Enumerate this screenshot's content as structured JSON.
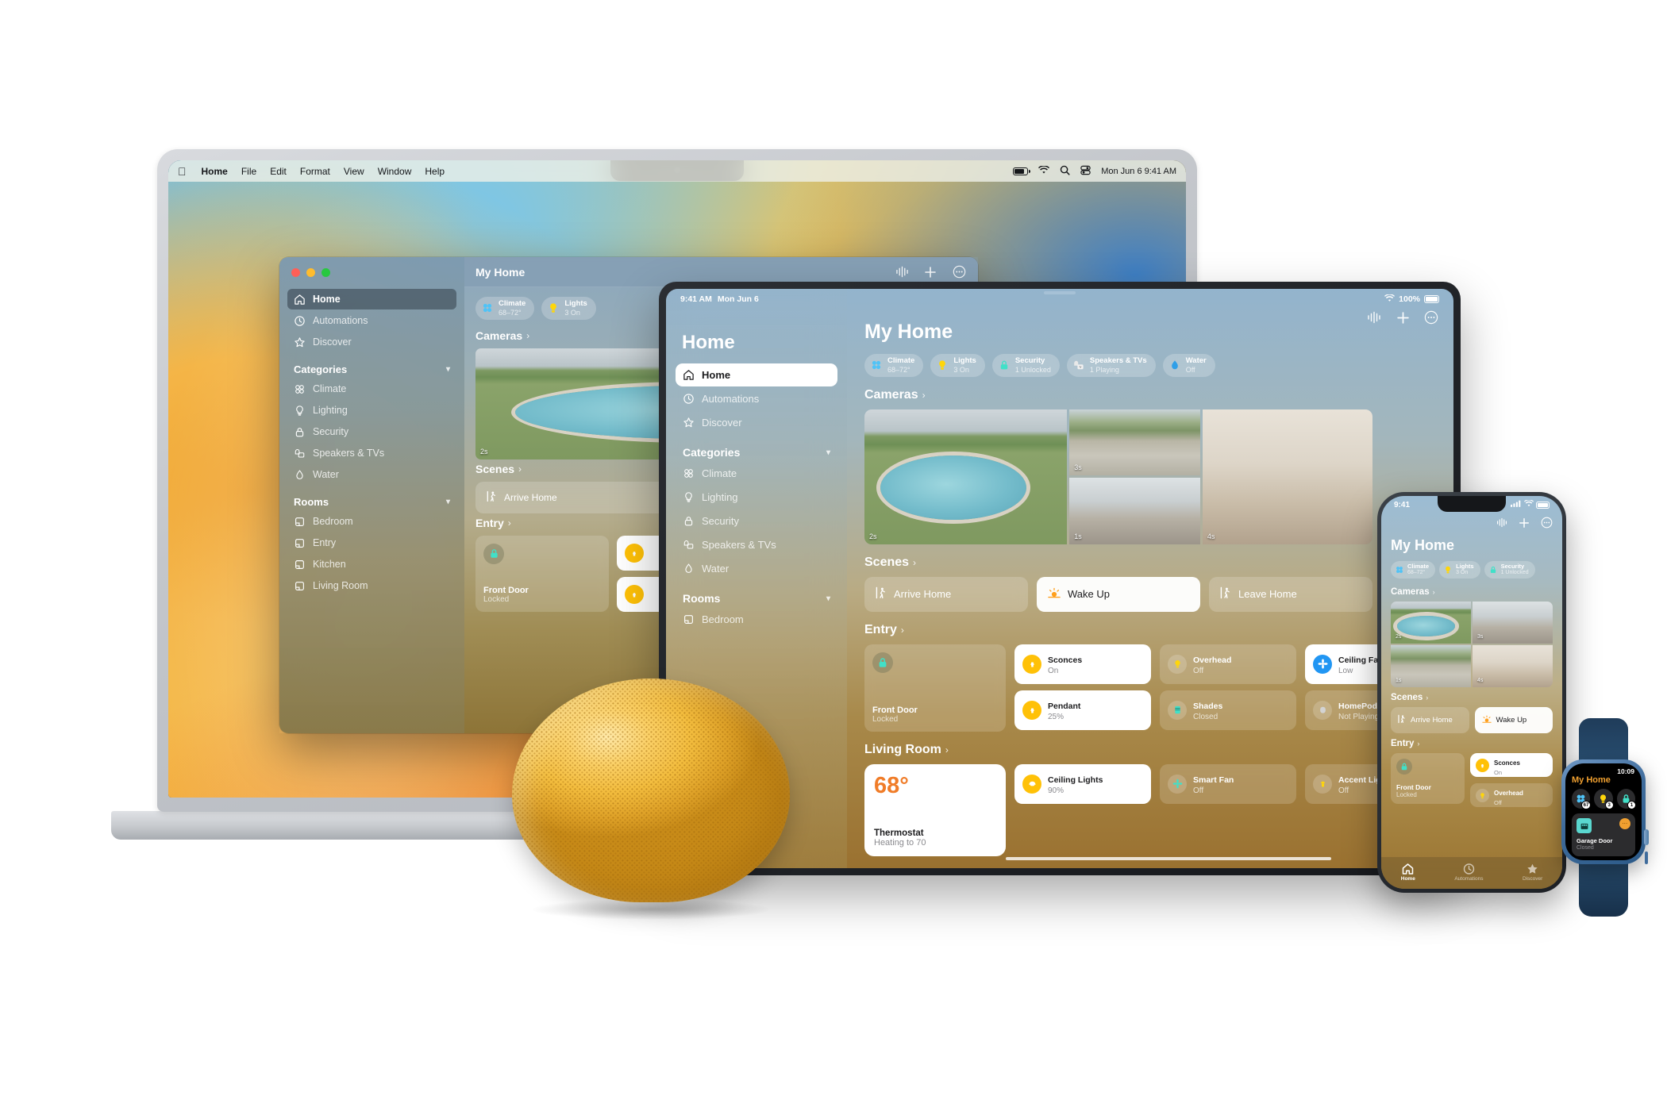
{
  "mac": {
    "menubar": {
      "apple": "apple-logo",
      "items": [
        "Home",
        "File",
        "Edit",
        "Format",
        "View",
        "Window",
        "Help"
      ],
      "status_icons": [
        "battery-icon",
        "wifi-icon",
        "search-icon",
        "control-center-icon"
      ],
      "datetime": "Mon Jun 6  9:41 AM"
    },
    "window": {
      "title": "My Home",
      "toolbar_icons": [
        "siri-waveform-icon",
        "add-icon",
        "more-options-icon"
      ],
      "sidebar": {
        "primary": [
          {
            "label": "Home",
            "icon": "house-icon",
            "selected": true
          },
          {
            "label": "Automations",
            "icon": "clock-automation-icon",
            "selected": false
          },
          {
            "label": "Discover",
            "icon": "star-icon",
            "selected": false
          }
        ],
        "categories_header": "Categories",
        "categories": [
          {
            "label": "Climate",
            "icon": "fan-icon"
          },
          {
            "label": "Lighting",
            "icon": "bulb-icon"
          },
          {
            "label": "Security",
            "icon": "lock-icon"
          },
          {
            "label": "Speakers & TVs",
            "icon": "speaker-tv-icon"
          },
          {
            "label": "Water",
            "icon": "water-drop-icon"
          }
        ],
        "rooms_header": "Rooms",
        "rooms": [
          {
            "label": "Bedroom",
            "icon": "room-icon"
          },
          {
            "label": "Entry",
            "icon": "room-icon"
          },
          {
            "label": "Kitchen",
            "icon": "room-icon"
          },
          {
            "label": "Living Room",
            "icon": "room-icon"
          }
        ]
      },
      "status_pills": [
        {
          "name": "Climate",
          "value": "68–72°",
          "icon": "fan-icon",
          "color": "#4fc3f7"
        },
        {
          "name": "Lights",
          "value": "3 On",
          "icon": "bulb-icon",
          "color": "#ffd60a"
        }
      ],
      "sections": {
        "cameras": "Cameras",
        "scenes": "Scenes",
        "entry": "Entry"
      },
      "cameras": [
        {
          "name": "pool-camera",
          "timestamp": "2s"
        }
      ],
      "scenes": [
        {
          "label": "Arrive Home",
          "icon": "walk-in-icon",
          "active": false
        }
      ],
      "entry": {
        "lock": {
          "name": "Front Door",
          "state": "Locked",
          "icon": "lock-icon"
        }
      }
    },
    "dock": [
      {
        "name": "finder-icon"
      },
      {
        "name": "launchpad-icon"
      },
      {
        "name": "safari-icon"
      },
      {
        "name": "messages-icon"
      },
      {
        "name": "mail-icon"
      },
      {
        "name": "maps-icon"
      },
      {
        "name": "photos-icon"
      }
    ]
  },
  "ipad": {
    "status": {
      "time": "9:41 AM",
      "date": "Mon Jun 6",
      "wifi": "wifi-icon",
      "battery_pct": "100%"
    },
    "sidebar": {
      "title": "Home",
      "primary": [
        {
          "label": "Home",
          "icon": "house-icon",
          "selected": true
        },
        {
          "label": "Automations",
          "icon": "clock-automation-icon",
          "selected": false
        },
        {
          "label": "Discover",
          "icon": "star-icon",
          "selected": false
        }
      ],
      "categories_header": "Categories",
      "categories": [
        {
          "label": "Climate",
          "icon": "fan-icon"
        },
        {
          "label": "Lighting",
          "icon": "bulb-icon"
        },
        {
          "label": "Security",
          "icon": "lock-icon"
        },
        {
          "label": "Speakers & TVs",
          "icon": "speaker-tv-icon"
        },
        {
          "label": "Water",
          "icon": "water-drop-icon"
        }
      ],
      "rooms_header": "Rooms",
      "rooms": [
        {
          "label": "Bedroom",
          "icon": "room-icon"
        }
      ]
    },
    "title": "My Home",
    "toolbar_icons": [
      "siri-waveform-icon",
      "add-icon",
      "more-options-icon"
    ],
    "status_pills": [
      {
        "name": "Climate",
        "value": "68–72°",
        "icon": "fan-icon"
      },
      {
        "name": "Lights",
        "value": "3 On",
        "icon": "bulb-icon"
      },
      {
        "name": "Security",
        "value": "1 Unlocked",
        "icon": "lock-icon"
      },
      {
        "name": "Speakers & TVs",
        "value": "1 Playing",
        "icon": "speaker-tv-icon"
      },
      {
        "name": "Water",
        "value": "Off",
        "icon": "water-drop-icon"
      }
    ],
    "sections": {
      "cameras": "Cameras",
      "scenes": "Scenes",
      "entry": "Entry",
      "living_room": "Living Room"
    },
    "cameras": [
      {
        "name": "pool-camera",
        "timestamp": "2s"
      },
      {
        "name": "driveway-camera",
        "timestamp": "3s"
      },
      {
        "name": "garage-camera",
        "timestamp": "1s"
      },
      {
        "name": "living-room-camera",
        "timestamp": "4s"
      }
    ],
    "scenes": [
      {
        "label": "Arrive Home",
        "icon": "walk-in-icon",
        "active": false
      },
      {
        "label": "Wake Up",
        "icon": "sunrise-icon",
        "active": true
      },
      {
        "label": "Leave Home",
        "icon": "walk-out-icon",
        "active": false
      }
    ],
    "entry": {
      "lock": {
        "name": "Front Door",
        "state": "Locked",
        "icon": "lock-icon"
      },
      "tiles": [
        {
          "name": "Sconces",
          "state": "On",
          "icon": "sconce-icon",
          "on": true
        },
        {
          "name": "Pendant",
          "state": "25%",
          "icon": "pendant-icon",
          "on": true
        },
        {
          "name": "Overhead",
          "state": "Off",
          "icon": "bulb-icon",
          "on": false
        },
        {
          "name": "Shades",
          "state": "Closed",
          "icon": "shades-icon",
          "on": false
        },
        {
          "name": "Ceiling Fan",
          "state": "Low",
          "icon": "fan-icon",
          "on": true
        },
        {
          "name": "HomePod",
          "state": "Not Playing",
          "icon": "homepod-icon",
          "on": false
        }
      ]
    },
    "living_room": {
      "thermostat": {
        "temperature": "68°",
        "name": "Thermostat",
        "state": "Heating to 70"
      },
      "tiles": [
        {
          "name": "Ceiling Lights",
          "state": "90%",
          "icon": "ceiling-light-icon",
          "on": true
        },
        {
          "name": "Smart Fan",
          "state": "Off",
          "icon": "fan-icon",
          "on": false
        },
        {
          "name": "Accent Lights",
          "state": "Off",
          "icon": "accent-light-icon",
          "on": false
        }
      ]
    }
  },
  "iphone": {
    "status": {
      "time": "9:41",
      "icons": [
        "cellular-icon",
        "wifi-icon",
        "battery-icon"
      ]
    },
    "toolbar_icons": [
      "siri-waveform-icon",
      "add-icon",
      "more-options-icon"
    ],
    "title": "My Home",
    "status_pills": [
      {
        "name": "Climate",
        "value": "68–72°",
        "icon": "fan-icon"
      },
      {
        "name": "Lights",
        "value": "3 On",
        "icon": "bulb-icon"
      },
      {
        "name": "Security",
        "value": "1 Unlocked",
        "icon": "lock-icon"
      }
    ],
    "sections": {
      "cameras": "Cameras",
      "scenes": "Scenes",
      "entry": "Entry"
    },
    "cameras": [
      {
        "name": "pool-camera",
        "timestamp": "2s"
      },
      {
        "name": "garage-camera",
        "timestamp": "3s"
      },
      {
        "name": "driveway-camera",
        "timestamp": "1s"
      },
      {
        "name": "living-room-camera",
        "timestamp": "4s"
      }
    ],
    "scenes": [
      {
        "label": "Arrive Home",
        "icon": "walk-in-icon",
        "active": false
      },
      {
        "label": "Wake Up",
        "icon": "sunrise-icon",
        "active": true
      }
    ],
    "entry": {
      "lock": {
        "name": "Front Door",
        "state": "Locked",
        "icon": "lock-icon"
      },
      "tiles": [
        {
          "name": "Sconces",
          "state": "On",
          "icon": "sconce-icon",
          "on": true
        },
        {
          "name": "Overhead",
          "state": "Off",
          "icon": "bulb-icon",
          "on": false
        }
      ]
    },
    "tabs": [
      {
        "label": "Home",
        "icon": "house-icon",
        "active": true
      },
      {
        "label": "Automations",
        "icon": "clock-automation-icon",
        "active": false
      },
      {
        "label": "Discover",
        "icon": "star-icon",
        "active": false
      }
    ]
  },
  "watch": {
    "time": "10:09",
    "title": "My Home",
    "title_color": "#f0a030",
    "circles": [
      {
        "name": "climate-status",
        "icon": "fan-icon",
        "badge": "67"
      },
      {
        "name": "lights-status",
        "icon": "bulb-icon",
        "badge": "3"
      },
      {
        "name": "security-status",
        "icon": "lock-icon",
        "badge": "1"
      }
    ],
    "tile": {
      "name": "Garage Door",
      "state": "Closed",
      "icon": "garage-icon",
      "menu": "•••"
    }
  },
  "homepod": {
    "name": "HomePod mini",
    "color": "#f3bd3e"
  }
}
